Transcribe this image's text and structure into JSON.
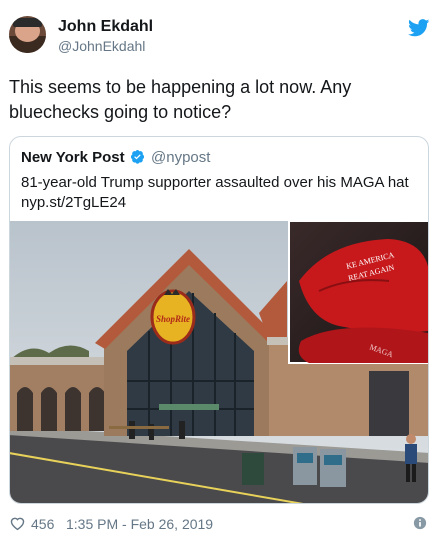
{
  "author": {
    "display_name": "John Ekdahl",
    "handle": "@JohnEkdahl"
  },
  "tweet": {
    "text": "This seems to be happening a lot now. Any bluechecks going to notice?"
  },
  "quoted": {
    "display_name": "New York Post",
    "handle": "@nypost",
    "text": "81-year-old Trump supporter assaulted over his MAGA hat nyp.st/2TgLE24",
    "image": {
      "store_sign": "ShopRite",
      "hat_text_line1": "KE AMERICA",
      "hat_text_line2": "REAT AGAIN",
      "hat_text_brim": "MAGA"
    }
  },
  "footer": {
    "likes": "456",
    "timestamp": "1:35 PM - Feb 26, 2019"
  },
  "colors": {
    "twitter_blue": "#1da1f2",
    "secondary_text": "#657786",
    "border": "#ccd6dd"
  },
  "icons": {
    "bird": "twitter-bird-icon",
    "verified": "verified-badge-icon",
    "like": "heart-icon",
    "info": "info-icon"
  }
}
